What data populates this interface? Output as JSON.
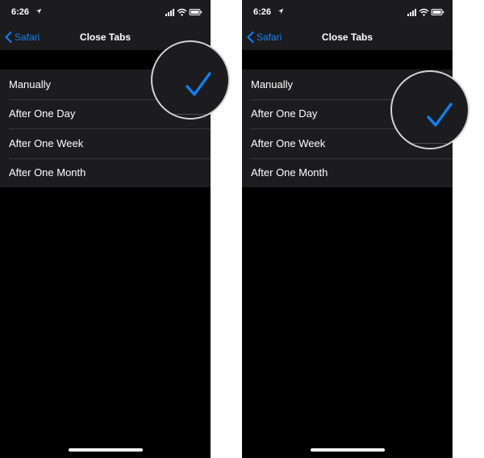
{
  "screens": [
    {
      "status_bar": {
        "time": "6:26"
      },
      "nav": {
        "back_label": "Safari",
        "title": "Close Tabs"
      },
      "options": [
        {
          "label": "Manually",
          "selected": true
        },
        {
          "label": "After One Day",
          "selected": false
        },
        {
          "label": "After One Week",
          "selected": false
        },
        {
          "label": "After One Month",
          "selected": false
        }
      ]
    },
    {
      "status_bar": {
        "time": "6:26"
      },
      "nav": {
        "back_label": "Safari",
        "title": "Close Tabs"
      },
      "options": [
        {
          "label": "Manually",
          "selected": false
        },
        {
          "label": "After One Day",
          "selected": true
        },
        {
          "label": "After One Week",
          "selected": false
        },
        {
          "label": "After One Month",
          "selected": false
        }
      ]
    }
  ],
  "colors": {
    "accent": "#0a84ff",
    "background": "#000000",
    "bar_background": "#1c1c1e",
    "separator": "#38383a",
    "text": "#ffffff"
  },
  "icons": [
    "location-arrow-icon",
    "cellular-signal-icon",
    "wifi-icon",
    "battery-icon",
    "back-chevron-icon",
    "checkmark-icon"
  ]
}
